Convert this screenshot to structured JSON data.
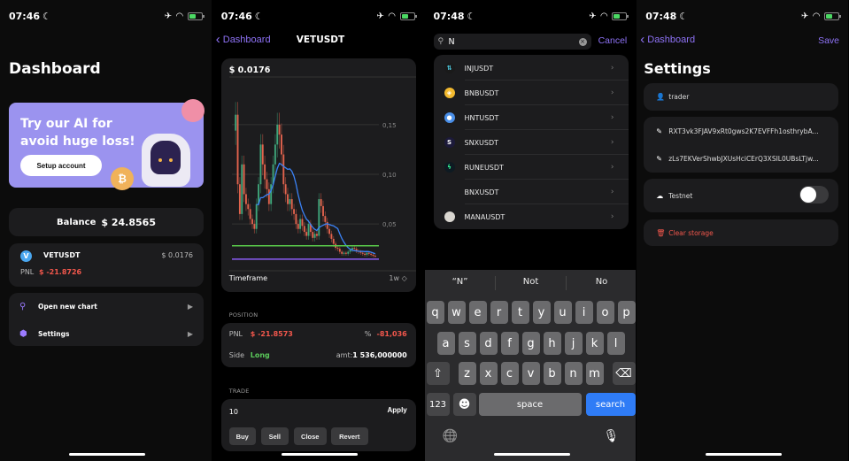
{
  "screens": [
    {
      "status": {
        "time": "07:46"
      },
      "title": "Dashboard",
      "banner": {
        "text_line1": "Try our AI for",
        "text_line2": "avoid huge loss!",
        "button": "Setup account"
      },
      "balance": {
        "label": "Balance",
        "value": "$ 24.8565"
      },
      "position": {
        "symbol": "VETUSDT",
        "price": "$ 0.0176",
        "pnl_label": "PNL",
        "pnl_value": "$ -21.8726",
        "icon_letter": "V"
      },
      "menu": [
        {
          "label": "Open new chart",
          "icon": "search-icon"
        },
        {
          "label": "Settings",
          "icon": "gear-icon"
        }
      ]
    },
    {
      "status": {
        "time": "07:46"
      },
      "back_label": "Dashboard",
      "title": "VETUSDT",
      "chart_price": "$ 0.0176",
      "timeframe_label": "Timeframe",
      "timeframe_value": "1w ◇",
      "position_section": "POSITION",
      "pnl_label": "PNL",
      "pnl_value": "$ -21.8573",
      "pct_label": "%",
      "pct_value": "-81,036",
      "side_label": "Side",
      "side_value": "Long",
      "amt_label": "amt:",
      "amt_value": "1 536,000000",
      "trade_section": "TRADE",
      "trade_input": "10",
      "apply_label": "Apply",
      "trade_buttons": [
        "Buy",
        "Sell",
        "Close",
        "Revert"
      ]
    },
    {
      "status": {
        "time": "07:48"
      },
      "search_value": "N",
      "cancel_label": "Cancel",
      "results": [
        {
          "name": "INJUSDT",
          "icon_color": "#1a1a1a",
          "icon_fg": "#4fd1e8",
          "glyph": "⇅"
        },
        {
          "name": "BNBUSDT",
          "icon_color": "#f3ba2f",
          "icon_fg": "#fff",
          "glyph": "◈"
        },
        {
          "name": "HNTUSDT",
          "icon_color": "#4a8fe8",
          "icon_fg": "#fff",
          "glyph": "●"
        },
        {
          "name": "SNXUSDT",
          "icon_color": "#1c1a3a",
          "icon_fg": "#fff",
          "glyph": "S"
        },
        {
          "name": "RUNEUSDT",
          "icon_color": "#0e1a22",
          "icon_fg": "#33ff99",
          "glyph": "ϟ"
        },
        {
          "name": "BNXUSDT",
          "icon_color": "transparent",
          "icon_fg": "#fff",
          "glyph": ""
        },
        {
          "name": "MANAUSDT",
          "icon_color": "#d9d6d0",
          "icon_fg": "#999",
          "glyph": ""
        }
      ],
      "suggestions": [
        "“N”",
        "Not",
        "No"
      ],
      "keyboard": {
        "row1": [
          "q",
          "w",
          "e",
          "r",
          "t",
          "y",
          "u",
          "i",
          "o",
          "p"
        ],
        "row2": [
          "a",
          "s",
          "d",
          "f",
          "g",
          "h",
          "j",
          "k",
          "l"
        ],
        "row3": [
          "z",
          "x",
          "c",
          "v",
          "b",
          "n",
          "m"
        ],
        "shift": "⇧",
        "backspace": "⌫",
        "numbers": "123",
        "emoji": "☻",
        "space": "space",
        "search": "search",
        "globe": "🌐",
        "mic": "🎙"
      }
    },
    {
      "status": {
        "time": "07:48"
      },
      "back_label": "Dashboard",
      "save_label": "Save",
      "title": "Settings",
      "username": "trader",
      "api_key": "RXT3vk3FJAV9xRt0gws2K7EVFFh1osthrybA...",
      "api_secret": "zLs7EKVerShwbJXUsHciCErQ3XSIL0UBsLTjw...",
      "testnet_label": "Testnet",
      "testnet_enabled": false,
      "clear_label": "Clear storage"
    }
  ],
  "chart_data": {
    "type": "candlestick",
    "symbol": "VETUSDT",
    "timeframe": "1w",
    "y_ticks": [
      "0,15",
      "0,10",
      "0,05"
    ],
    "y_tick_values": [
      0.15,
      0.1,
      0.05
    ],
    "ylim": [
      0.01,
      0.19
    ],
    "close": [
      0.16,
      0.09,
      0.06,
      0.11,
      0.08,
      0.07,
      0.065,
      0.055,
      0.05,
      0.045,
      0.07,
      0.09,
      0.13,
      0.11,
      0.095,
      0.085,
      0.07,
      0.09,
      0.11,
      0.13,
      0.15,
      0.14,
      0.12,
      0.09,
      0.08,
      0.07,
      0.075,
      0.065,
      0.06,
      0.05,
      0.045,
      0.055,
      0.048,
      0.042,
      0.038,
      0.05,
      0.042,
      0.036,
      0.04,
      0.038,
      0.075,
      0.068,
      0.058,
      0.052,
      0.045,
      0.04,
      0.035,
      0.03,
      0.026,
      0.025,
      0.022,
      0.02,
      0.021,
      0.02,
      0.022,
      0.024,
      0.026,
      0.025,
      0.023,
      0.022,
      0.021,
      0.02,
      0.019,
      0.021,
      0.02,
      0.019,
      0.018,
      0.0176
    ],
    "ma_line": "ma (blue)",
    "support_level": 0.028,
    "entry_level": 0.0146,
    "colors": {
      "up": "#3fa57a",
      "down": "#e2634d",
      "ma": "#3b82f6",
      "support": "#59c94a",
      "entry": "#8b5cf6",
      "grid": "#333"
    }
  },
  "colors": {
    "accent": "#8e72f6",
    "negative": "#f2574c",
    "positive": "#5ac85a",
    "card": "#1c1c1e",
    "keyboard_action": "#2f7cf6"
  }
}
